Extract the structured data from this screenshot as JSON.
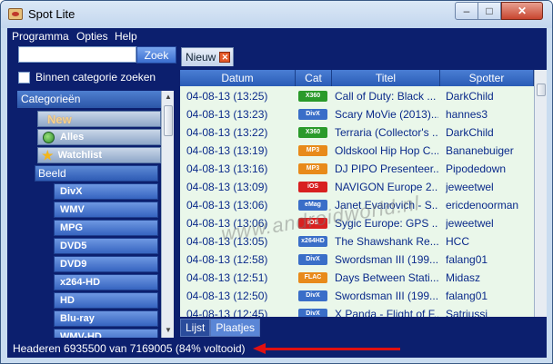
{
  "window": {
    "title": "Spot Lite"
  },
  "window_controls": {
    "minimize": "–",
    "maximize": "□",
    "close": "✕"
  },
  "menu": [
    "Programma",
    "Opties",
    "Help"
  ],
  "search": {
    "value": "",
    "button_label": "Zoek"
  },
  "category_search": {
    "label": "Binnen categorie zoeken",
    "checked": false
  },
  "tree": {
    "header": "Categorieën",
    "top_items": [
      {
        "label": "New",
        "icon": "new-icon"
      },
      {
        "label": "Alles",
        "icon": "globe-icon"
      },
      {
        "label": "Watchlist",
        "icon": "star-icon"
      }
    ],
    "group": "Beeld",
    "sub_items": [
      "DivX",
      "WMV",
      "MPG",
      "DVD5",
      "DVD9",
      "x264-HD",
      "HD",
      "Blu-ray",
      "WMV-HD"
    ]
  },
  "tabs": {
    "active": "Nieuw",
    "close_icon": "close-icon"
  },
  "table": {
    "columns": [
      "Datum",
      "Cat",
      "Titel",
      "Spotter"
    ],
    "rows": [
      {
        "datum": "04-08-13 (13:25)",
        "cat": "X360",
        "cat_color": "#2a9a2a",
        "titel": "Call of Duty: Black ...",
        "spotter": "DarkChild"
      },
      {
        "datum": "04-08-13 (13:23)",
        "cat": "DivX",
        "cat_color": "#3a6ec8",
        "titel": "Scary MoVie (2013)...",
        "spotter": "hannes3"
      },
      {
        "datum": "04-08-13 (13:22)",
        "cat": "X360",
        "cat_color": "#2a9a2a",
        "titel": "Terraria (Collector's ...",
        "spotter": "DarkChild"
      },
      {
        "datum": "04-08-13 (13:19)",
        "cat": "MP3",
        "cat_color": "#e88a1a",
        "titel": "Oldskool Hip Hop C...",
        "spotter": "Bananebuiger"
      },
      {
        "datum": "04-08-13 (13:16)",
        "cat": "MP3",
        "cat_color": "#e88a1a",
        "titel": "DJ PIPO Presenteer...",
        "spotter": "Pipodedown"
      },
      {
        "datum": "04-08-13 (13:09)",
        "cat": "iOS",
        "cat_color": "#d82020",
        "titel": "NAVIGON Europe 2...",
        "spotter": "jeweetwel"
      },
      {
        "datum": "04-08-13 (13:06)",
        "cat": "eMag",
        "cat_color": "#3a6ec8",
        "titel": "Janet Evanovich - S...",
        "spotter": "ericdenoorman"
      },
      {
        "datum": "04-08-13 (13:06)",
        "cat": "iOS",
        "cat_color": "#d82020",
        "titel": "Sygic Europe: GPS ...",
        "spotter": "jeweetwel"
      },
      {
        "datum": "04-08-13 (13:05)",
        "cat": "x264HD",
        "cat_color": "#3a6ec8",
        "titel": "The Shawshank Re...",
        "spotter": "HCC"
      },
      {
        "datum": "04-08-13 (12:58)",
        "cat": "DivX",
        "cat_color": "#3a6ec8",
        "titel": "Swordsman III (199...",
        "spotter": "falang01"
      },
      {
        "datum": "04-08-13 (12:51)",
        "cat": "FLAC",
        "cat_color": "#e88a1a",
        "titel": "Days Between Stati...",
        "spotter": "Midasz"
      },
      {
        "datum": "04-08-13 (12:50)",
        "cat": "DivX",
        "cat_color": "#3a6ec8",
        "titel": "Swordsman III (199...",
        "spotter": "falang01"
      },
      {
        "datum": "04-08-13 (12:45)",
        "cat": "DivX",
        "cat_color": "#3a6ec8",
        "titel": "X Panda - Flight of F...",
        "spotter": "Satriussi"
      }
    ]
  },
  "bottom_tabs": [
    {
      "label": "Lijst",
      "active": false
    },
    {
      "label": "Plaatjes",
      "active": true
    }
  ],
  "status": {
    "text": "Headeren 6935500 van 7169005 (84% voltooid)",
    "progress_percent": 84
  },
  "annotation": {
    "arrow_color": "#e01010"
  },
  "watermark": "www.androidworld.nl"
}
